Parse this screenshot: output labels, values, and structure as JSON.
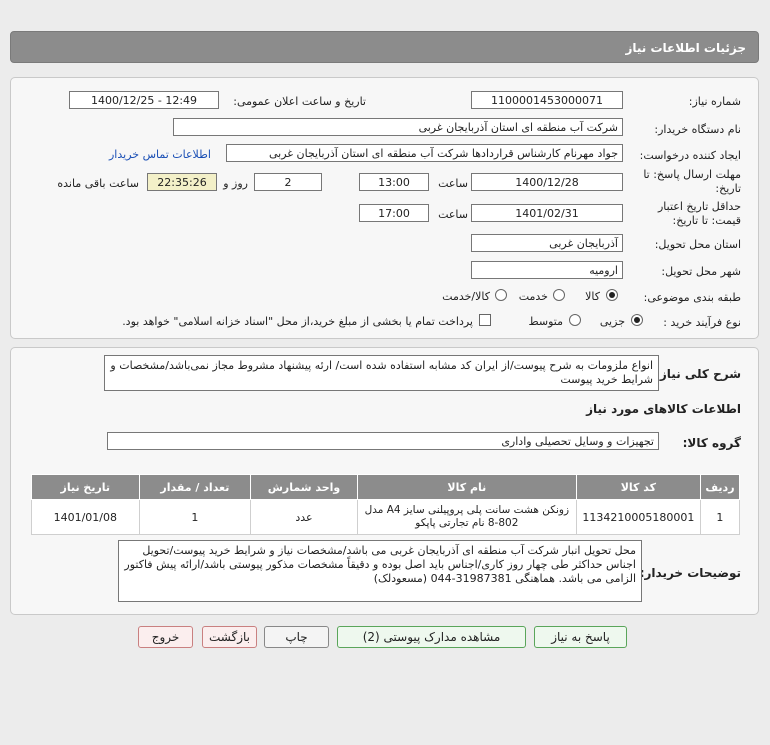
{
  "header": {
    "title": "جزئیات اطلاعات نیاز"
  },
  "form": {
    "need_number_label": "شماره نیاز:",
    "need_number": "1100001453000071",
    "announce_label": "تاریخ و ساعت اعلان عمومی:",
    "announce_value": "1400/12/25 - 12:49",
    "buyer_label": "نام دستگاه خریدار:",
    "buyer_value": "شرکت آب منطقه ای استان آذربایجان غربی",
    "requester_label": "ایجاد کننده درخواست:",
    "requester_value": "جواد مهرنام کارشناس قراردادها شرکت آب منطقه ای استان آذربایجان غربی",
    "contact_link": "اطلاعات تماس خریدار",
    "deadline_label_1": "مهلت ارسال پاسخ: تا",
    "deadline_label_2": "تاریخ:",
    "deadline_date": "1400/12/28",
    "time_label": "ساعت",
    "deadline_time": "13:00",
    "days_value": "2",
    "days_label": "روز و",
    "remaining_time": "22:35:26",
    "remaining_label": "ساعت باقی مانده",
    "validity_label_1": "حداقل تاریخ اعتبار",
    "validity_label_2": "قیمت: تا تاریخ:",
    "validity_date": "1401/02/31",
    "validity_time_label": "ساعت",
    "validity_time": "17:00",
    "province_label": "استان محل تحویل:",
    "province_value": "آذربایجان غربی",
    "city_label": "شهر محل تحویل:",
    "city_value": "ارومیه",
    "category_label": "طبقه بندی موضوعی:",
    "category_options": [
      "کالا",
      "خدمت",
      "کالا/خدمت"
    ],
    "process_label": "نوع فرآیند خرید :",
    "process_options": [
      "جزیی",
      "متوسط"
    ],
    "payment_note": "پرداخت تمام یا بخشی از مبلغ خرید،از محل \"اسناد خزانه اسلامی\" خواهد بود."
  },
  "details": {
    "summary_label": "شرح کلی نیاز:",
    "summary_text": "انواع ملزومات به شرح پیوست/از ایران کد مشابه استفاده شده است/ ارئه پیشنهاد مشروط مجاز نمی‌باشد/مشخصات و شرایط خرید پیوست",
    "goods_info_title": "اطلاعات کالاهای مورد نیاز",
    "group_label": "گروه کالا:",
    "group_value": "تجهیزات و وسایل تحصیلی واداری",
    "table": {
      "headers": [
        "ردیف",
        "کد کالا",
        "نام کالا",
        "واحد شمارش",
        "تعداد / مقدار",
        "تاریخ نیاز"
      ],
      "rows": [
        [
          "1",
          "1134210005180001",
          "زونکن هشت سانت پلی پروپیلنی سایز A4 مدل 802-8 نام تجارتی پاپکو",
          "عدد",
          "1",
          "1401/01/08"
        ]
      ]
    },
    "buyer_notes_label": "توضیحات خریدار:",
    "buyer_notes": "محل تحویل انبار شرکت آب منطقه ای آذربایجان غربی می باشد/مشخصات نیاز و شرایط خرید پیوست/تحویل اجناس حداکثر طی چهار روز کاری/اجناس باید اصل بوده و دقیقاً مشخصات مذکور پیوستی باشد/ارائه پیش فاکتور الزامی می باشد. هماهنگی 31987381-044 (مسعودلک)"
  },
  "buttons": {
    "reply": "پاسخ به نیاز",
    "attachments": "مشاهده مدارک پیوستی (2)",
    "print": "چاپ",
    "back": "بازگشت",
    "exit": "خروج"
  }
}
